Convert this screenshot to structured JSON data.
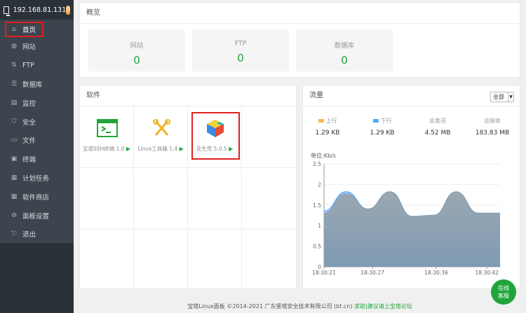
{
  "sidebar": {
    "ip": "192.168.81.131",
    "badge": "0",
    "items": [
      {
        "label": "首页",
        "icon": "home-icon",
        "active": true
      },
      {
        "label": "网站",
        "icon": "globe-icon"
      },
      {
        "label": "FTP",
        "icon": "ftp-icon"
      },
      {
        "label": "数据库",
        "icon": "database-icon"
      },
      {
        "label": "监控",
        "icon": "monitor-icon"
      },
      {
        "label": "安全",
        "icon": "shield-icon"
      },
      {
        "label": "文件",
        "icon": "folder-icon"
      },
      {
        "label": "终端",
        "icon": "terminal-icon"
      },
      {
        "label": "计划任务",
        "icon": "calendar-icon"
      },
      {
        "label": "软件商店",
        "icon": "grid-icon"
      },
      {
        "label": "面板设置",
        "icon": "gear-icon"
      },
      {
        "label": "退出",
        "icon": "logout-icon"
      }
    ]
  },
  "overview": {
    "title": "概览",
    "cards": [
      {
        "label": "网站",
        "value": "0"
      },
      {
        "label": "FTP",
        "value": "0"
      },
      {
        "label": "数据库",
        "value": "0"
      }
    ]
  },
  "software": {
    "title": "软件",
    "items": [
      {
        "name": "宝塔SSH终端 1.0",
        "icon": "terminal-app-icon"
      },
      {
        "name": "Linux工具箱 1.4",
        "icon": "tools-icon"
      },
      {
        "name": "花生壳 5.0.5",
        "icon": "cube-icon"
      }
    ]
  },
  "traffic": {
    "title": "流量",
    "select": "全部",
    "stats": [
      {
        "label": "上行",
        "value": "1.29 KB",
        "color": "#f7b851"
      },
      {
        "label": "下行",
        "value": "1.29 KB",
        "color": "#52a9ff"
      },
      {
        "label": "总发送",
        "value": "4.52 MB"
      },
      {
        "label": "总接收",
        "value": "183.83 MB"
      }
    ],
    "unit": "单位:Kb/s"
  },
  "chart_data": {
    "type": "area",
    "ylim": [
      0,
      2.5
    ],
    "yticks": [
      "0",
      "0.5",
      "1",
      "1.5",
      "2",
      "2.5"
    ],
    "xticks": [
      "18:30:21",
      "18:30:27",
      "18:30:36",
      "18:30:42"
    ],
    "series": [
      {
        "name": "上行",
        "color": "#52a9ff",
        "x": [
          0,
          1,
          2,
          3,
          4,
          5,
          6,
          7,
          8
        ],
        "values": [
          1.35,
          1.82,
          1.4,
          1.82,
          1.22,
          1.25,
          1.82,
          1.3,
          1.3
        ]
      },
      {
        "name": "下行",
        "color": "#8fa3b3",
        "x": [
          0,
          1,
          2,
          3,
          4,
          5,
          6,
          7,
          8
        ],
        "values": [
          1.3,
          1.77,
          1.4,
          1.82,
          1.22,
          1.25,
          1.82,
          1.3,
          1.3
        ]
      }
    ]
  },
  "footer": {
    "text": "宝塔Linux面板 ©2014-2021 广东堡塔安全技术有限公司 (bt.cn)",
    "link": "求助|建议请上宝塔论坛"
  },
  "kefu": {
    "line1": "在线",
    "line2": "客服"
  }
}
